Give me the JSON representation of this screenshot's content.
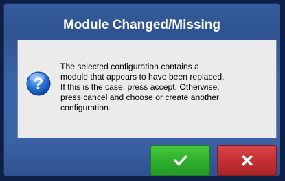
{
  "dialog": {
    "title": "Module Changed/Missing",
    "message": "The selected configuration contains a\nmodule that appears to have been replaced.\nIf this is the case, press accept.  Otherwise,\npress cancel and choose or create another\nconfiguration.",
    "icon": "info-question-icon"
  },
  "buttons": {
    "accept": {
      "icon": "checkmark-icon",
      "color": "#2fae2b"
    },
    "cancel": {
      "icon": "x-icon",
      "color": "#c22f33"
    }
  },
  "colors": {
    "dialog_background": "#3a62a5",
    "panel_background": "#ebebeb",
    "title_text": "#ffffff"
  }
}
